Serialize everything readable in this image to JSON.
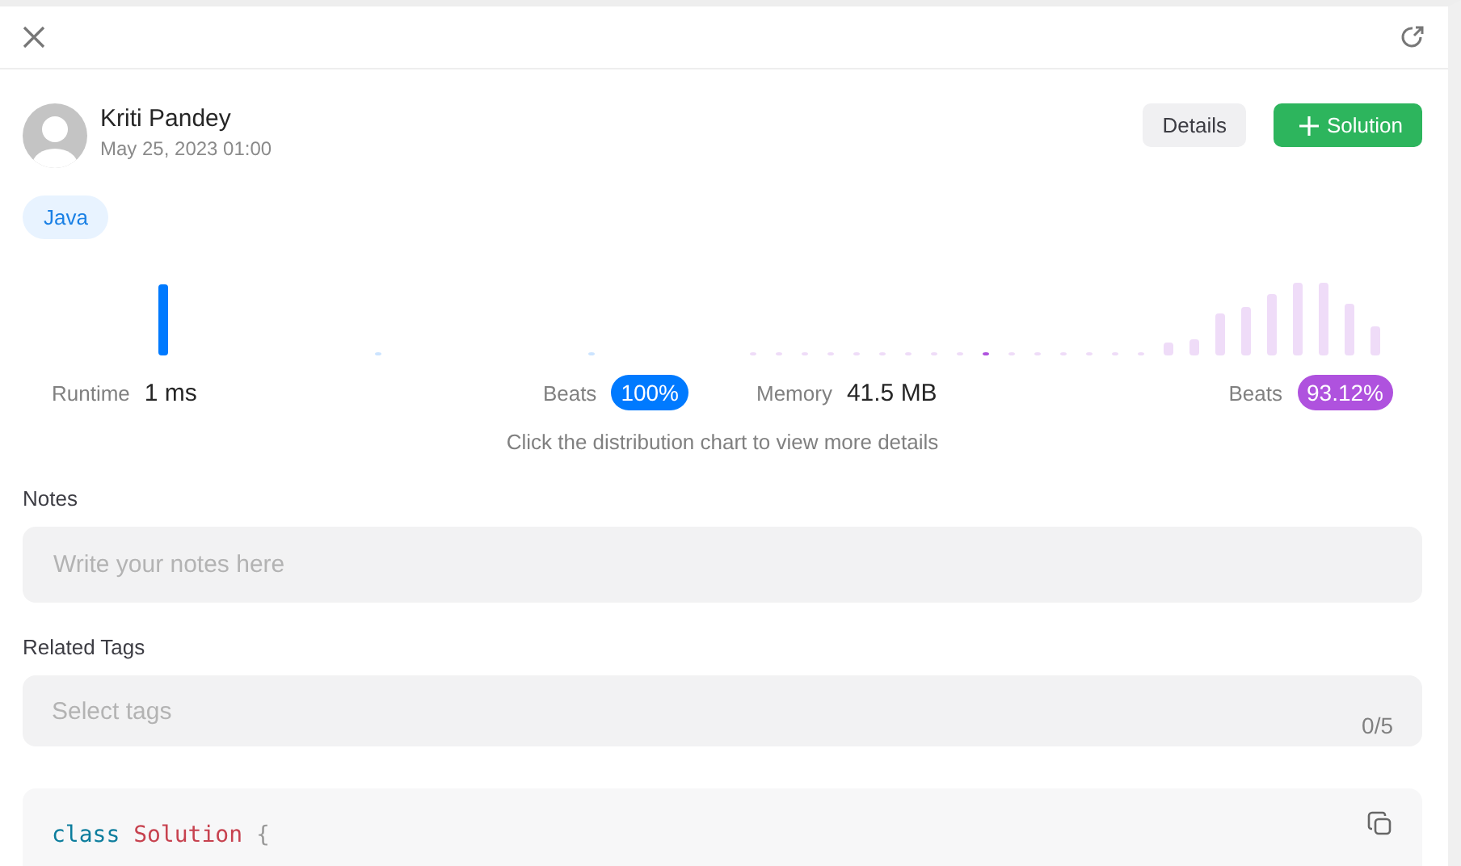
{
  "author": {
    "name": "Kriti Pandey",
    "date": "May 25, 2023 01:00"
  },
  "actions": [
    {
      "kind": "plain",
      "label": "Details"
    },
    {
      "kind": "primary",
      "label": "Solution"
    }
  ],
  "language_tag": "Java",
  "stats": [
    {
      "kind": "runtime",
      "label": "Runtime",
      "value": "1 ms",
      "beats_label": "Beats",
      "beats": "100%",
      "color": "#007aff"
    },
    {
      "kind": "memory",
      "label": "Memory",
      "value": "41.5 MB",
      "beats_label": "Beats",
      "beats": "93.12%",
      "color": "#af52de"
    }
  ],
  "chart_hint": "Click the distribution chart to view more details",
  "notes": {
    "label": "Notes",
    "placeholder": "Write your notes here"
  },
  "related_tags": {
    "label": "Related Tags",
    "placeholder": "Select tags",
    "count": "0/5"
  },
  "code": [
    [
      {
        "kind": "keyword",
        "text": "class"
      },
      {
        "kind": "type",
        "text": "Solution"
      },
      {
        "kind": "punct",
        "text": "{"
      }
    ]
  ]
}
